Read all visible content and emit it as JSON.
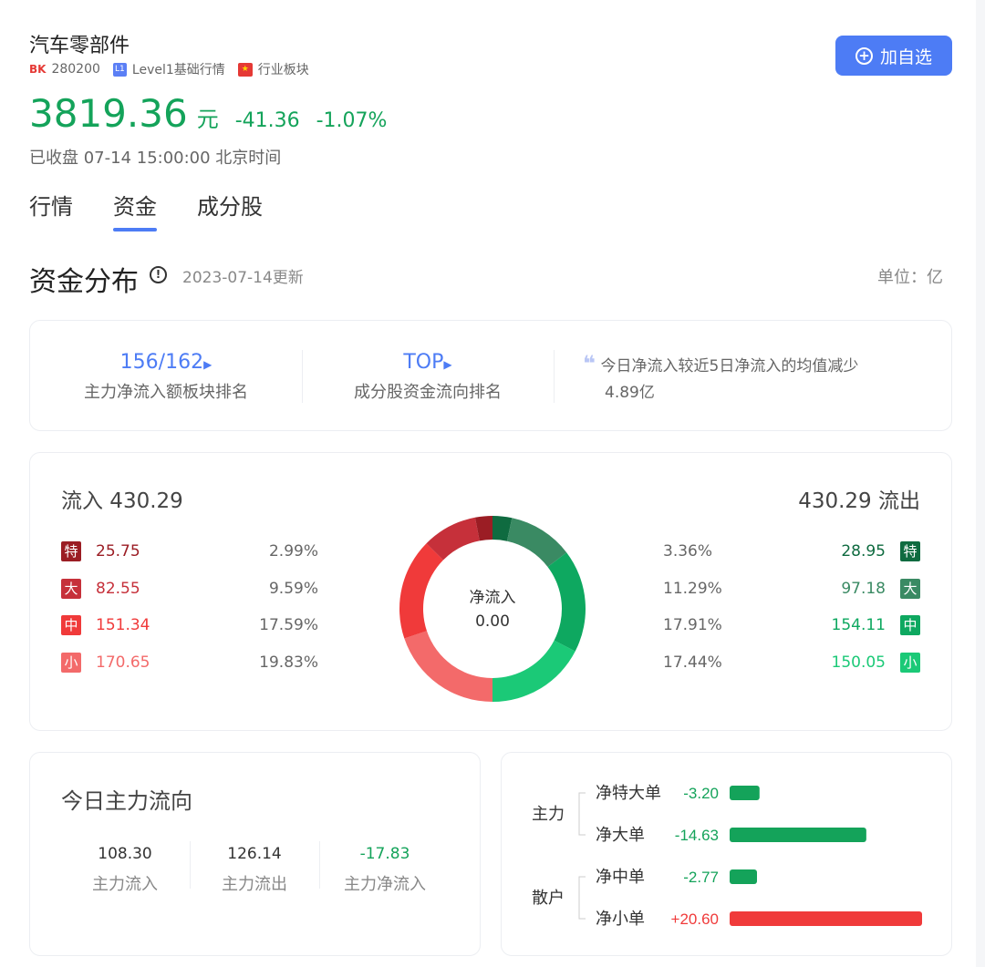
{
  "header": {
    "name": "汽车零部件",
    "bk_tag": "BK",
    "code": "280200",
    "level_tag": "L1",
    "level_text": "Level1基础行情",
    "board_text": "行业板块",
    "add_label": "加自选",
    "price": "3819.36",
    "price_unit": "元",
    "change": "-41.36",
    "change_pct": "-1.07%",
    "close_time": "已收盘 07-14 15:00:00 北京时间",
    "colors": {
      "down": "#14a35a",
      "accent": "#4d7cf5"
    }
  },
  "tabs": [
    {
      "label": "行情",
      "active": false
    },
    {
      "label": "资金",
      "active": true
    },
    {
      "label": "成分股",
      "active": false
    }
  ],
  "section": {
    "title": "资金分布",
    "date": "2023-07-14更新",
    "unit": "单位：亿"
  },
  "rank": {
    "board_rank": "156/162",
    "board_rank_label": "主力净流入额板块排名",
    "top_label": "TOP",
    "top_sub": "成分股资金流向排名",
    "quote_line1": "今日净流入较近5日净流入的均值减少",
    "quote_line2": "4.89亿"
  },
  "flow": {
    "inflow_label": "流入 430.29",
    "outflow_label": "430.29 流出",
    "center_label": "净流入",
    "center_value": "0.00",
    "inflows": [
      {
        "tag": "特",
        "value": "25.75",
        "pct": "2.99%",
        "color": "#9b1d24"
      },
      {
        "tag": "大",
        "value": "82.55",
        "pct": "9.59%",
        "color": "#c6303a"
      },
      {
        "tag": "中",
        "value": "151.34",
        "pct": "17.59%",
        "color": "#f03a3a"
      },
      {
        "tag": "小",
        "value": "170.65",
        "pct": "19.83%",
        "color": "#f36a6a"
      }
    ],
    "outflows": [
      {
        "tag": "特",
        "value": "28.95",
        "pct": "3.36%",
        "color": "#0f6b40"
      },
      {
        "tag": "大",
        "value": "97.18",
        "pct": "11.29%",
        "color": "#3a8a63"
      },
      {
        "tag": "中",
        "value": "154.11",
        "pct": "17.91%",
        "color": "#0ea860"
      },
      {
        "tag": "小",
        "value": "150.05",
        "pct": "17.44%",
        "color": "#1bc977"
      }
    ]
  },
  "today": {
    "title": "今日主力流向",
    "stats": [
      {
        "value": "108.30",
        "label": "主力流入",
        "color": "#333333"
      },
      {
        "value": "126.14",
        "label": "主力流出",
        "color": "#333333"
      },
      {
        "value": "-17.83",
        "label": "主力净流入",
        "color": "#14a35a"
      }
    ]
  },
  "net_bars": {
    "groups": [
      {
        "label": "主力",
        "items": [
          {
            "label": "净特大单",
            "value": "-3.20",
            "num": -3.2
          },
          {
            "label": "净大单",
            "value": "-14.63",
            "num": -14.63
          }
        ]
      },
      {
        "label": "散户",
        "items": [
          {
            "label": "净中单",
            "value": "-2.77",
            "num": -2.77
          },
          {
            "label": "净小单",
            "value": "+20.60",
            "num": 20.6
          }
        ]
      }
    ],
    "colors": {
      "neg": "#14a35a",
      "pos": "#f03a3a"
    }
  },
  "chart_data": {
    "type": "pie",
    "categories": [
      "特(入)",
      "大(入)",
      "中(入)",
      "小(入)",
      "特(出)",
      "大(出)",
      "中(出)",
      "小(出)"
    ],
    "values": [
      25.75,
      82.55,
      151.34,
      170.65,
      28.95,
      97.18,
      154.11,
      150.05
    ],
    "percents": [
      2.99,
      9.59,
      17.59,
      19.83,
      3.36,
      11.29,
      17.91,
      17.44
    ]
  }
}
